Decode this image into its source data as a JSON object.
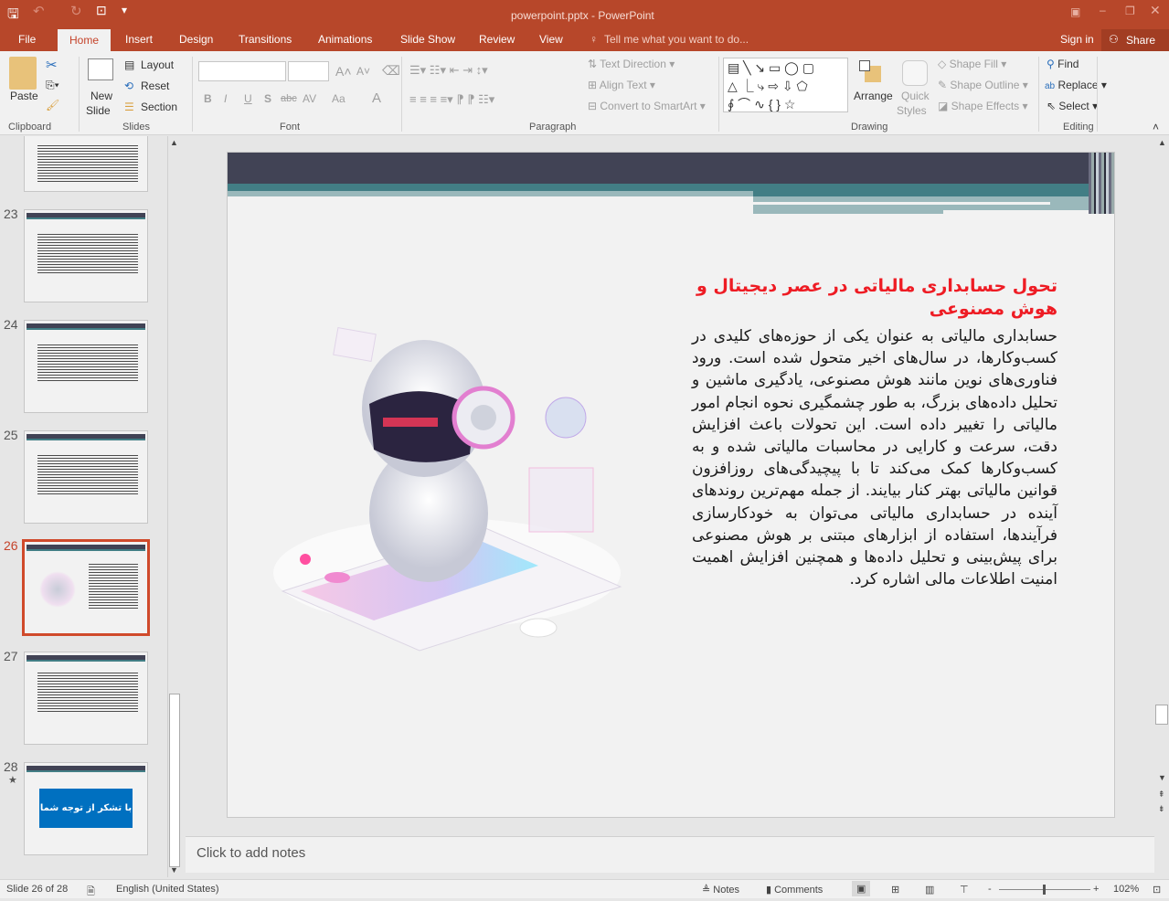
{
  "window": {
    "title": "powerpoint.pptx - PowerPoint",
    "accent": "#b7472a"
  },
  "qat": {
    "save": "save-icon",
    "undo": "undo-icon",
    "redo": "redo-icon",
    "present": "present-icon"
  },
  "tabs": [
    "File",
    "Home",
    "Insert",
    "Design",
    "Transitions",
    "Animations",
    "Slide Show",
    "Review",
    "View"
  ],
  "tell_me": "Tell me what you want to do...",
  "sign_in": "Sign in",
  "share": "Share",
  "ribbon": {
    "clipboard": {
      "label": "Clipboard",
      "paste": "Paste"
    },
    "slides": {
      "label": "Slides",
      "new_slide": "New",
      "new_slide2": "Slide",
      "layout": "Layout",
      "reset": "Reset",
      "section": "Section"
    },
    "font": {
      "label": "Font",
      "bold": "B",
      "italic": "I",
      "underline": "U",
      "shadow": "S",
      "strike": "abc",
      "spacing": "AV",
      "case": "Aa",
      "color": "A"
    },
    "paragraph": {
      "label": "Paragraph",
      "text_direction": "Text Direction",
      "align_text": "Align Text",
      "convert_smartart": "Convert to SmartArt"
    },
    "drawing": {
      "label": "Drawing",
      "arrange": "Arrange",
      "quick_styles": "Quick",
      "quick_styles2": "Styles",
      "shape_fill": "Shape Fill",
      "shape_outline": "Shape Outline",
      "shape_effects": "Shape Effects"
    },
    "editing": {
      "label": "Editing",
      "find": "Find",
      "replace": "Replace",
      "select": "Select"
    }
  },
  "thumbnails": [
    {
      "num": "23"
    },
    {
      "num": "24"
    },
    {
      "num": "25"
    },
    {
      "num": "26",
      "selected": true
    },
    {
      "num": "27"
    },
    {
      "num": "28",
      "star": "★",
      "button_text": "با تشکر از توجه شما"
    }
  ],
  "slide": {
    "title": "تحول حسابداری مالیاتی در عصر دیجیتال و هوش مصنوعی",
    "body": "حسابداری مالیاتی به عنوان یکی از حوزه‌های کلیدی در کسب‌وکارها، در سال‌های اخیر متحول شده است. ورود فناوری‌های نوین مانند هوش مصنوعی، یادگیری ماشین و تحلیل داده‌های بزرگ، به طور چشمگیری نحوه انجام امور مالیاتی را تغییر داده است. این تحولات باعث افزایش دقت، سرعت و کارایی در محاسبات مالیاتی شده و به کسب‌وکارها کمک می‌کند تا با پیچیدگی‌های روزافزون قوانین مالیاتی بهتر کنار بیایند. از جمله مهم‌ترین روندهای آینده در حسابداری مالیاتی می‌توان به خودکارسازی فرآیندها، استفاده از ابزارهای مبتنی بر هوش مصنوعی برای پیش‌بینی و تحلیل داده‌ها و همچنین افزایش اهمیت امنیت اطلاعات مالی اشاره کرد.",
    "title_color": "#ee1c24"
  },
  "notes_placeholder": "Click to add notes",
  "status": {
    "slide": "Slide 26 of 28",
    "language": "English (United States)",
    "notes": "Notes",
    "comments": "Comments",
    "zoom": "102%",
    "zoom_level_percent": 102
  }
}
